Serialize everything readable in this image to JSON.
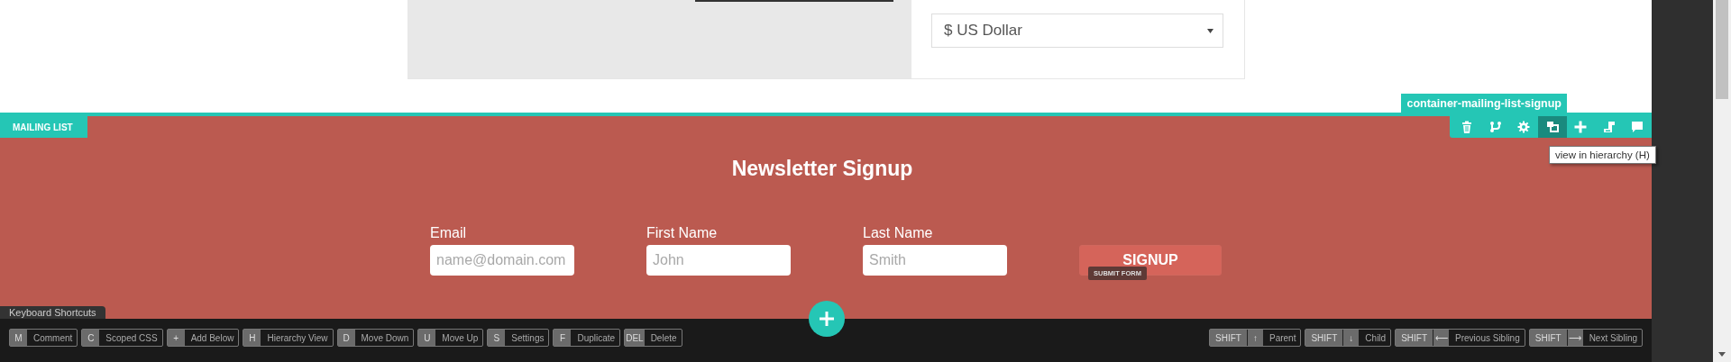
{
  "currency_select": {
    "value": "$ US Dollar"
  },
  "section": {
    "tag": "MAILING LIST",
    "container_label": "container-mailing-list-signup",
    "toolbar": [
      {
        "kind": "delete",
        "selected": false
      },
      {
        "kind": "branch",
        "selected": false
      },
      {
        "kind": "settings",
        "selected": false
      },
      {
        "kind": "hierarchy",
        "selected": true
      },
      {
        "kind": "add",
        "selected": false
      },
      {
        "kind": "layout",
        "selected": false
      },
      {
        "kind": "comment",
        "selected": false
      }
    ],
    "tooltip": "view in hierarchy (H)",
    "title": "Newsletter Signup",
    "fields": [
      {
        "label": "Email",
        "placeholder": "name@domain.com"
      },
      {
        "label": "First Name",
        "placeholder": "John"
      },
      {
        "label": "Last Name",
        "placeholder": "Smith"
      }
    ],
    "button": "SIGNUP",
    "button_badge": "SUBMIT FORM"
  },
  "shortcuts": {
    "tab": "Keyboard Shortcuts",
    "left": [
      {
        "key": "M",
        "label": "Comment"
      },
      {
        "key": "C",
        "label": "Scoped CSS"
      },
      {
        "key": "+",
        "label": "Add Below"
      },
      {
        "key": "H",
        "label": "Hierarchy View"
      },
      {
        "key": "D",
        "label": "Move Down"
      },
      {
        "key": "U",
        "label": "Move Up"
      },
      {
        "key": "S",
        "label": "Settings"
      },
      {
        "key": "F",
        "label": "Duplicate"
      },
      {
        "key": "DEL",
        "label": "Delete"
      }
    ],
    "right": [
      {
        "mod": "SHIFT",
        "key": "↑",
        "label": "Parent"
      },
      {
        "mod": "SHIFT",
        "key": "↓",
        "label": "Child"
      },
      {
        "mod": "SHIFT",
        "key": "⟵",
        "label": "Previous Sibling"
      },
      {
        "mod": "SHIFT",
        "key": "⟶",
        "label": "Next Sibling"
      }
    ]
  }
}
